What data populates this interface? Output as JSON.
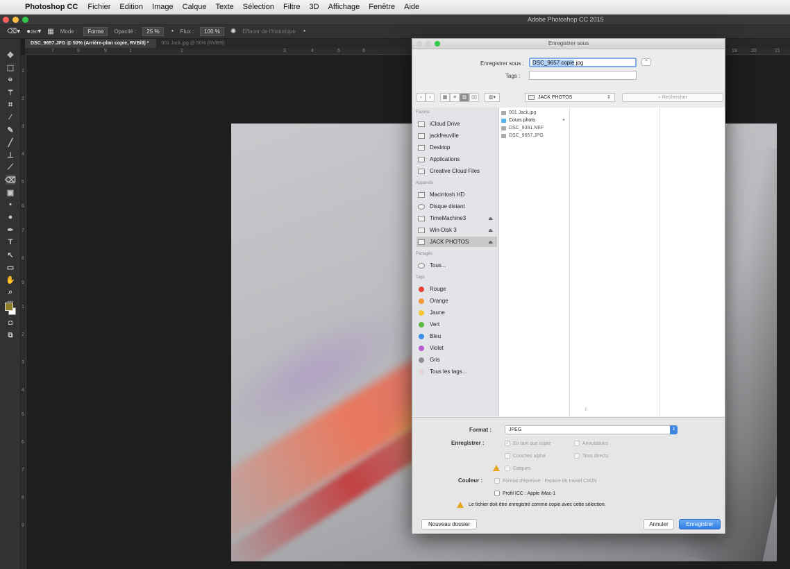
{
  "menubar": {
    "apple": "",
    "app": "Photoshop CC",
    "items": [
      "Fichier",
      "Edition",
      "Image",
      "Calque",
      "Texte",
      "Sélection",
      "Filtre",
      "3D",
      "Affichage",
      "Fenêtre",
      "Aide"
    ]
  },
  "ps_window": {
    "title": "Adobe Photoshop CC 2015",
    "light_colors": [
      "#fc605c",
      "#fdbc40",
      "#34c84a"
    ]
  },
  "options_bar": {
    "brush_size": "250",
    "mode_label": "Mode :",
    "mode_value": "Forme",
    "opacity_label": "Opacité :",
    "opacity_value": "25 %",
    "flow_label": "Flux :",
    "flow_value": "100 %",
    "history_label": "Effacer de l'historique"
  },
  "tabs": [
    {
      "label": "DSC_9657.JPG @ 50% (Arrière-plan copie, RVB/8) *",
      "active": true
    },
    {
      "label": "001 Jack.jpg @ 50% (RVB/8)",
      "active": false
    }
  ],
  "ruler_top": [
    "7",
    "8",
    "9",
    "1",
    "2",
    "3",
    "4",
    "5",
    "6",
    "19",
    "20",
    "21"
  ],
  "ruler_left": [
    "1",
    "2",
    "3",
    "4",
    "5",
    "6",
    "7",
    "8",
    "9",
    "1",
    "2",
    "3",
    "4",
    "5",
    "6",
    "7",
    "8",
    "9"
  ],
  "toolbar": {
    "tools": [
      {
        "name": "move-tool-icon",
        "glyph": "✥"
      },
      {
        "name": "marquee-tool-icon",
        "glyph": "⬚"
      },
      {
        "name": "lasso-tool-icon",
        "glyph": "ဓ"
      },
      {
        "name": "magic-wand-tool-icon",
        "glyph": "⚚"
      },
      {
        "name": "crop-tool-icon",
        "glyph": "⌗"
      },
      {
        "name": "eyedropper-tool-icon",
        "glyph": "⁄"
      },
      {
        "name": "healing-brush-tool-icon",
        "glyph": "✎"
      },
      {
        "name": "brush-tool-icon",
        "glyph": "╱"
      },
      {
        "name": "clone-stamp-tool-icon",
        "glyph": "⊥"
      },
      {
        "name": "history-brush-tool-icon",
        "glyph": "⟋"
      },
      {
        "name": "eraser-tool-icon",
        "glyph": "⌫"
      },
      {
        "name": "gradient-tool-icon",
        "glyph": "▣"
      },
      {
        "name": "blur-tool-icon",
        "glyph": "•"
      },
      {
        "name": "dodge-tool-icon",
        "glyph": "●"
      },
      {
        "name": "pen-tool-icon",
        "glyph": "✒"
      },
      {
        "name": "type-tool-icon",
        "glyph": "T"
      },
      {
        "name": "path-selection-tool-icon",
        "glyph": "↖"
      },
      {
        "name": "rectangle-tool-icon",
        "glyph": "▭"
      },
      {
        "name": "hand-tool-icon",
        "glyph": "✋"
      },
      {
        "name": "zoom-tool-icon",
        "glyph": "⌕"
      },
      {
        "name": "more-tools-icon",
        "glyph": "…"
      }
    ],
    "foreground_color": "#8b7d2a",
    "background_color": "#ffffff"
  },
  "dialog": {
    "title": "Enregistrer sous",
    "save_as_label": "Enregistrer sous :",
    "filename_selected": "DSC_9657 copie",
    "filename_ext": ".jpg",
    "tags_label": "Tags :",
    "tags_value": "",
    "location": "JACK PHOTOS",
    "search_placeholder": "Rechercher",
    "sidebar": {
      "favorites_header": "Favoris",
      "favorites": [
        "iCloud Drive",
        "jackfreuville",
        "Desktop",
        "Applications",
        "Creative Cloud Files"
      ],
      "devices_header": "Appareils",
      "devices": [
        "Macintosh HD",
        "Disque distant",
        "TimeMachine3",
        "Win-Disk 3",
        "JACK PHOTOS"
      ],
      "shared_header": "Partagés",
      "shared": [
        "Tous..."
      ],
      "tags_header": "Tags",
      "tags": [
        {
          "label": "Rouge",
          "color": "#e9433b"
        },
        {
          "label": "Orange",
          "color": "#f09a3a"
        },
        {
          "label": "Jaune",
          "color": "#f3c433"
        },
        {
          "label": "Vert",
          "color": "#5db742"
        },
        {
          "label": "Bleu",
          "color": "#3d8ee4"
        },
        {
          "label": "Violet",
          "color": "#b85cd0"
        },
        {
          "label": "Gris",
          "color": "#8e8e93"
        },
        {
          "label": "Tous les tags...",
          "color": "#e4d4d6"
        }
      ]
    },
    "files": [
      {
        "label": "001 Jack.jpg",
        "folder": false
      },
      {
        "label": "Cours photo",
        "folder": true
      },
      {
        "label": "DSC_9391.NEF",
        "folder": false
      },
      {
        "label": "DSC_9657.JPG",
        "folder": false
      }
    ],
    "format_label": "Format :",
    "format_value": "JPEG",
    "save_label": "Enregistrer :",
    "options": {
      "as_copy": "En tant que copie",
      "annotations": "Annotations",
      "alpha": "Couches alpha",
      "spot": "Tons directs",
      "layers": "Calques"
    },
    "color_label": "Couleur :",
    "proof": "Format d'épreuve : Espace de travail CMJN",
    "icc": "Profil ICC : Apple iMac-1",
    "warning": "Le fichier doit être enregistré comme copie avec cette sélection.",
    "new_folder": "Nouveau dossier",
    "cancel": "Annuler",
    "save": "Enregistrer"
  }
}
